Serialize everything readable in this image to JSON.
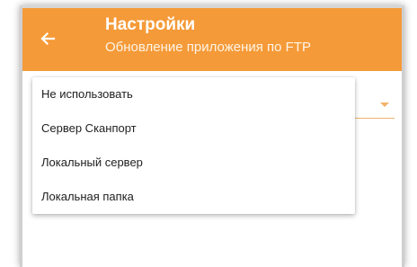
{
  "appbar": {
    "title": "Настройки",
    "subtitle": "Обновление приложения по FTP",
    "back_icon": "arrow-left-icon",
    "background_color": "#f59a38"
  },
  "spinner": {
    "selected_value": "",
    "arrow_icon": "triangle-down-icon",
    "accent_color": "#f4b26a"
  },
  "dropdown": {
    "options": [
      "Не использовать",
      "Сервер Сканпорт",
      "Локальный сервер",
      "Локальная папка"
    ]
  }
}
